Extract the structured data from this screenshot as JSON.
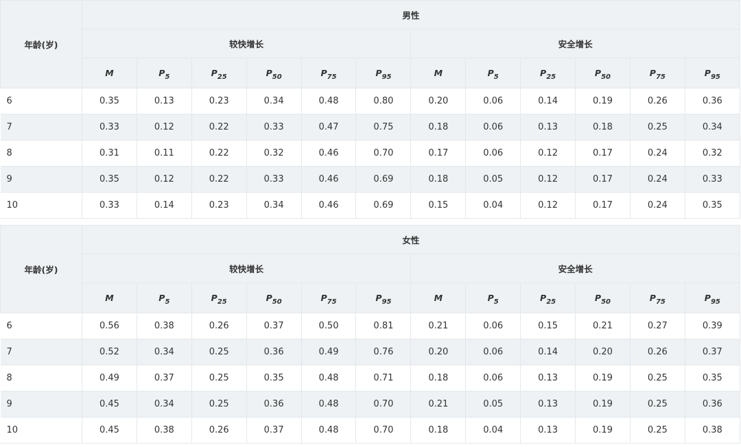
{
  "tables": [
    {
      "gender": "男性",
      "age_header": "年龄(岁)",
      "groups": [
        "较快增长",
        "安全增长"
      ],
      "stats": [
        {
          "main": "M",
          "sub": ""
        },
        {
          "main": "P",
          "sub": "5"
        },
        {
          "main": "P",
          "sub": "25"
        },
        {
          "main": "P",
          "sub": "50"
        },
        {
          "main": "P",
          "sub": "75"
        },
        {
          "main": "P",
          "sub": "95"
        },
        {
          "main": "M",
          "sub": ""
        },
        {
          "main": "P",
          "sub": "5"
        },
        {
          "main": "P",
          "sub": "25"
        },
        {
          "main": "P",
          "sub": "50"
        },
        {
          "main": "P",
          "sub": "75"
        },
        {
          "main": "P",
          "sub": "95"
        }
      ],
      "rows": [
        {
          "age": "6",
          "values": [
            "0.35",
            "0.13",
            "0.23",
            "0.34",
            "0.48",
            "0.80",
            "0.20",
            "0.06",
            "0.14",
            "0.19",
            "0.26",
            "0.36"
          ]
        },
        {
          "age": "7",
          "values": [
            "0.33",
            "0.12",
            "0.22",
            "0.33",
            "0.47",
            "0.75",
            "0.18",
            "0.06",
            "0.13",
            "0.18",
            "0.25",
            "0.34"
          ]
        },
        {
          "age": "8",
          "values": [
            "0.31",
            "0.11",
            "0.22",
            "0.32",
            "0.46",
            "0.70",
            "0.17",
            "0.06",
            "0.12",
            "0.17",
            "0.24",
            "0.32"
          ]
        },
        {
          "age": "9",
          "values": [
            "0.35",
            "0.12",
            "0.22",
            "0.33",
            "0.46",
            "0.69",
            "0.18",
            "0.05",
            "0.12",
            "0.17",
            "0.24",
            "0.33"
          ]
        },
        {
          "age": "10",
          "values": [
            "0.33",
            "0.14",
            "0.23",
            "0.34",
            "0.46",
            "0.69",
            "0.15",
            "0.04",
            "0.12",
            "0.17",
            "0.24",
            "0.35"
          ]
        }
      ]
    },
    {
      "gender": "女性",
      "age_header": "年龄(岁)",
      "groups": [
        "较快增长",
        "安全增长"
      ],
      "stats": [
        {
          "main": "M",
          "sub": ""
        },
        {
          "main": "P",
          "sub": "5"
        },
        {
          "main": "P",
          "sub": "25"
        },
        {
          "main": "P",
          "sub": "50"
        },
        {
          "main": "P",
          "sub": "75"
        },
        {
          "main": "P",
          "sub": "95"
        },
        {
          "main": "M",
          "sub": ""
        },
        {
          "main": "P",
          "sub": "5"
        },
        {
          "main": "P",
          "sub": "25"
        },
        {
          "main": "P",
          "sub": "50"
        },
        {
          "main": "P",
          "sub": "75"
        },
        {
          "main": "P",
          "sub": "95"
        }
      ],
      "rows": [
        {
          "age": "6",
          "values": [
            "0.56",
            "0.38",
            "0.26",
            "0.37",
            "0.50",
            "0.81",
            "0.21",
            "0.06",
            "0.15",
            "0.21",
            "0.27",
            "0.39"
          ]
        },
        {
          "age": "7",
          "values": [
            "0.52",
            "0.34",
            "0.25",
            "0.36",
            "0.49",
            "0.76",
            "0.20",
            "0.06",
            "0.14",
            "0.20",
            "0.26",
            "0.37"
          ]
        },
        {
          "age": "8",
          "values": [
            "0.49",
            "0.37",
            "0.25",
            "0.35",
            "0.48",
            "0.71",
            "0.18",
            "0.06",
            "0.13",
            "0.19",
            "0.25",
            "0.35"
          ]
        },
        {
          "age": "9",
          "values": [
            "0.45",
            "0.34",
            "0.25",
            "0.36",
            "0.48",
            "0.70",
            "0.21",
            "0.05",
            "0.13",
            "0.19",
            "0.25",
            "0.36"
          ]
        },
        {
          "age": "10",
          "values": [
            "0.45",
            "0.38",
            "0.26",
            "0.37",
            "0.48",
            "0.70",
            "0.18",
            "0.04",
            "0.13",
            "0.19",
            "0.25",
            "0.38"
          ]
        }
      ]
    }
  ]
}
